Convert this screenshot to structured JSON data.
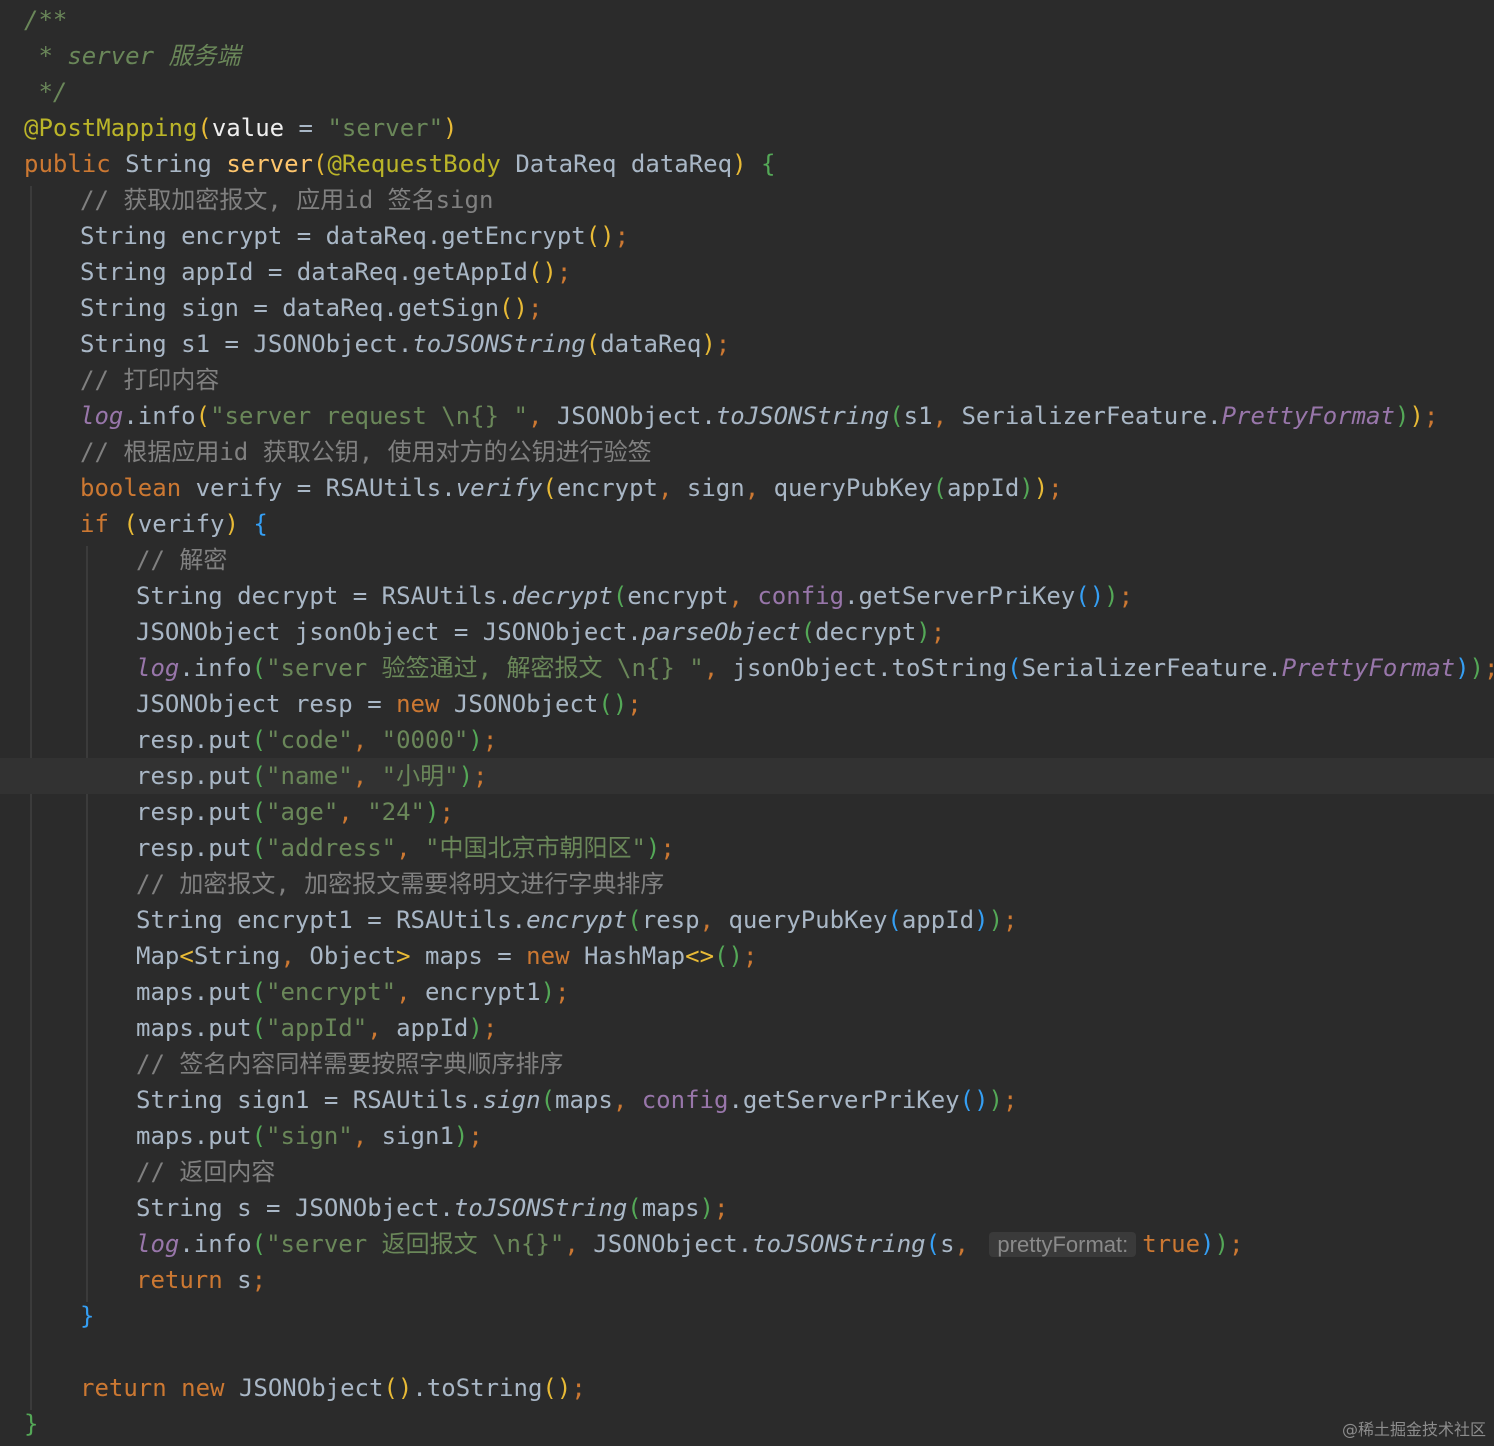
{
  "editor": {
    "lines": [
      {
        "indent": 0,
        "tokens": [
          {
            "t": "/**",
            "c": "comment"
          }
        ]
      },
      {
        "indent": 0,
        "tokens": [
          {
            "t": " * server 服务端",
            "c": "comment"
          }
        ]
      },
      {
        "indent": 0,
        "tokens": [
          {
            "t": " */",
            "c": "comment"
          }
        ]
      },
      {
        "indent": 0,
        "tokens": [
          {
            "t": "@PostMapping",
            "c": "anno"
          },
          {
            "t": "(",
            "c": "paren"
          },
          {
            "t": "value",
            "c": "param-name"
          },
          {
            "t": " = ",
            "c": "plain"
          },
          {
            "t": "\"server\"",
            "c": "str"
          },
          {
            "t": ")",
            "c": "paren"
          }
        ]
      },
      {
        "indent": 0,
        "tokens": [
          {
            "t": "public ",
            "c": "kw"
          },
          {
            "t": "String ",
            "c": "plain"
          },
          {
            "t": "server",
            "c": "fn"
          },
          {
            "t": "(",
            "c": "paren"
          },
          {
            "t": "@RequestBody ",
            "c": "anno"
          },
          {
            "t": "DataReq dataReq",
            "c": "plain"
          },
          {
            "t": ")",
            "c": "paren"
          },
          {
            "t": " {",
            "c": "paren2"
          }
        ]
      },
      {
        "indent": 1,
        "tokens": [
          {
            "t": "// 获取加密报文, 应用id 签名sign",
            "c": "linecomment"
          }
        ]
      },
      {
        "indent": 1,
        "tokens": [
          {
            "t": "String encrypt = dataReq.getEncrypt",
            "c": "plain"
          },
          {
            "t": "()",
            "c": "paren"
          },
          {
            "t": ";",
            "c": "punct"
          }
        ]
      },
      {
        "indent": 1,
        "tokens": [
          {
            "t": "String appId = dataReq.getAppId",
            "c": "plain"
          },
          {
            "t": "()",
            "c": "paren"
          },
          {
            "t": ";",
            "c": "punct"
          }
        ]
      },
      {
        "indent": 1,
        "tokens": [
          {
            "t": "String sign = dataReq.getSign",
            "c": "plain"
          },
          {
            "t": "()",
            "c": "paren"
          },
          {
            "t": ";",
            "c": "punct"
          }
        ]
      },
      {
        "indent": 1,
        "tokens": [
          {
            "t": "String s1 = JSONObject.",
            "c": "plain"
          },
          {
            "t": "toJSONString",
            "c": "static-call"
          },
          {
            "t": "(",
            "c": "paren"
          },
          {
            "t": "dataReq",
            "c": "plain"
          },
          {
            "t": ")",
            "c": "paren"
          },
          {
            "t": ";",
            "c": "punct"
          }
        ]
      },
      {
        "indent": 1,
        "tokens": [
          {
            "t": "// 打印内容",
            "c": "linecomment"
          }
        ]
      },
      {
        "indent": 1,
        "tokens": [
          {
            "t": "log",
            "c": "static-field"
          },
          {
            "t": ".info",
            "c": "plain"
          },
          {
            "t": "(",
            "c": "paren"
          },
          {
            "t": "\"server request \\n{} \"",
            "c": "str"
          },
          {
            "t": ", ",
            "c": "punct"
          },
          {
            "t": "JSONObject.",
            "c": "plain"
          },
          {
            "t": "toJSONString",
            "c": "static-call"
          },
          {
            "t": "(",
            "c": "paren2"
          },
          {
            "t": "s1",
            "c": "plain"
          },
          {
            "t": ", ",
            "c": "punct"
          },
          {
            "t": "SerializerFeature.",
            "c": "plain"
          },
          {
            "t": "PrettyFormat",
            "c": "static-field"
          },
          {
            "t": ")",
            "c": "paren2"
          },
          {
            "t": ")",
            "c": "paren"
          },
          {
            "t": ";",
            "c": "punct"
          }
        ]
      },
      {
        "indent": 1,
        "tokens": [
          {
            "t": "// 根据应用id 获取公钥, 使用对方的公钥进行验签",
            "c": "linecomment"
          }
        ]
      },
      {
        "indent": 1,
        "tokens": [
          {
            "t": "boolean ",
            "c": "kw"
          },
          {
            "t": "verify = RSAUtils.",
            "c": "plain"
          },
          {
            "t": "verify",
            "c": "static-call"
          },
          {
            "t": "(",
            "c": "paren"
          },
          {
            "t": "encrypt",
            "c": "plain"
          },
          {
            "t": ", ",
            "c": "punct"
          },
          {
            "t": "sign",
            "c": "plain"
          },
          {
            "t": ", ",
            "c": "punct"
          },
          {
            "t": "queryPubKey",
            "c": "plain"
          },
          {
            "t": "(",
            "c": "paren2"
          },
          {
            "t": "appId",
            "c": "plain"
          },
          {
            "t": ")",
            "c": "paren2"
          },
          {
            "t": ")",
            "c": "paren"
          },
          {
            "t": ";",
            "c": "punct"
          }
        ]
      },
      {
        "indent": 1,
        "tokens": [
          {
            "t": "if ",
            "c": "kw"
          },
          {
            "t": "(",
            "c": "paren"
          },
          {
            "t": "verify",
            "c": "plain"
          },
          {
            "t": ")",
            "c": "paren"
          },
          {
            "t": " {",
            "c": "paren3"
          }
        ]
      },
      {
        "indent": 2,
        "tokens": [
          {
            "t": "// 解密",
            "c": "linecomment"
          }
        ]
      },
      {
        "indent": 2,
        "tokens": [
          {
            "t": "String decrypt = RSAUtils.",
            "c": "plain"
          },
          {
            "t": "decrypt",
            "c": "static-call"
          },
          {
            "t": "(",
            "c": "paren2"
          },
          {
            "t": "encrypt",
            "c": "plain"
          },
          {
            "t": ", ",
            "c": "punct"
          },
          {
            "t": "config",
            "c": "field"
          },
          {
            "t": ".getServerPriKey",
            "c": "plain"
          },
          {
            "t": "()",
            "c": "paren3"
          },
          {
            "t": ")",
            "c": "paren2"
          },
          {
            "t": ";",
            "c": "punct"
          }
        ]
      },
      {
        "indent": 2,
        "tokens": [
          {
            "t": "JSONObject jsonObject = JSONObject.",
            "c": "plain"
          },
          {
            "t": "parseObject",
            "c": "static-call"
          },
          {
            "t": "(",
            "c": "paren2"
          },
          {
            "t": "decrypt",
            "c": "plain"
          },
          {
            "t": ")",
            "c": "paren2"
          },
          {
            "t": ";",
            "c": "punct"
          }
        ]
      },
      {
        "indent": 2,
        "tokens": [
          {
            "t": "log",
            "c": "static-field"
          },
          {
            "t": ".info",
            "c": "plain"
          },
          {
            "t": "(",
            "c": "paren2"
          },
          {
            "t": "\"server 验签通过, 解密报文 \\n{} \"",
            "c": "str"
          },
          {
            "t": ", ",
            "c": "punct"
          },
          {
            "t": "jsonObject.toString",
            "c": "plain"
          },
          {
            "t": "(",
            "c": "paren3"
          },
          {
            "t": "SerializerFeature.",
            "c": "plain"
          },
          {
            "t": "PrettyFormat",
            "c": "static-field"
          },
          {
            "t": ")",
            "c": "paren3"
          },
          {
            "t": ")",
            "c": "paren2"
          },
          {
            "t": ";",
            "c": "punct"
          }
        ]
      },
      {
        "indent": 2,
        "tokens": [
          {
            "t": "JSONObject resp = ",
            "c": "plain"
          },
          {
            "t": "new ",
            "c": "kw"
          },
          {
            "t": "JSONObject",
            "c": "plain"
          },
          {
            "t": "()",
            "c": "paren2"
          },
          {
            "t": ";",
            "c": "punct"
          }
        ]
      },
      {
        "indent": 2,
        "tokens": [
          {
            "t": "resp.put",
            "c": "plain"
          },
          {
            "t": "(",
            "c": "paren2"
          },
          {
            "t": "\"code\"",
            "c": "str"
          },
          {
            "t": ", ",
            "c": "punct"
          },
          {
            "t": "\"0000\"",
            "c": "str"
          },
          {
            "t": ")",
            "c": "paren2"
          },
          {
            "t": ";",
            "c": "punct"
          }
        ]
      },
      {
        "indent": 2,
        "current": true,
        "tokens": [
          {
            "t": "resp.put",
            "c": "plain"
          },
          {
            "t": "(",
            "c": "paren2"
          },
          {
            "t": "\"name\"",
            "c": "str"
          },
          {
            "t": ", ",
            "c": "punct"
          },
          {
            "t": "\"小明\"",
            "c": "str"
          },
          {
            "t": ")",
            "c": "paren2"
          },
          {
            "t": ";",
            "c": "punct"
          }
        ]
      },
      {
        "indent": 2,
        "tokens": [
          {
            "t": "resp.put",
            "c": "plain"
          },
          {
            "t": "(",
            "c": "paren2"
          },
          {
            "t": "\"age\"",
            "c": "str"
          },
          {
            "t": ", ",
            "c": "punct"
          },
          {
            "t": "\"24\"",
            "c": "str"
          },
          {
            "t": ")",
            "c": "paren2"
          },
          {
            "t": ";",
            "c": "punct"
          }
        ]
      },
      {
        "indent": 2,
        "tokens": [
          {
            "t": "resp.put",
            "c": "plain"
          },
          {
            "t": "(",
            "c": "paren2"
          },
          {
            "t": "\"address\"",
            "c": "str"
          },
          {
            "t": ", ",
            "c": "punct"
          },
          {
            "t": "\"中国北京市朝阳区\"",
            "c": "str"
          },
          {
            "t": ")",
            "c": "paren2"
          },
          {
            "t": ";",
            "c": "punct"
          }
        ]
      },
      {
        "indent": 2,
        "tokens": [
          {
            "t": "// 加密报文, 加密报文需要将明文进行字典排序",
            "c": "linecomment"
          }
        ]
      },
      {
        "indent": 2,
        "tokens": [
          {
            "t": "String encrypt1 = RSAUtils.",
            "c": "plain"
          },
          {
            "t": "encrypt",
            "c": "static-call"
          },
          {
            "t": "(",
            "c": "paren2"
          },
          {
            "t": "resp",
            "c": "plain"
          },
          {
            "t": ", ",
            "c": "punct"
          },
          {
            "t": "queryPubKey",
            "c": "plain"
          },
          {
            "t": "(",
            "c": "paren3"
          },
          {
            "t": "appId",
            "c": "plain"
          },
          {
            "t": ")",
            "c": "paren3"
          },
          {
            "t": ")",
            "c": "paren2"
          },
          {
            "t": ";",
            "c": "punct"
          }
        ]
      },
      {
        "indent": 2,
        "tokens": [
          {
            "t": "Map",
            "c": "plain"
          },
          {
            "t": "<",
            "c": "paren"
          },
          {
            "t": "String",
            "c": "plain"
          },
          {
            "t": ", ",
            "c": "punct"
          },
          {
            "t": "Object",
            "c": "plain"
          },
          {
            "t": ">",
            "c": "paren"
          },
          {
            "t": " maps = ",
            "c": "plain"
          },
          {
            "t": "new ",
            "c": "kw"
          },
          {
            "t": "HashMap",
            "c": "plain"
          },
          {
            "t": "<>",
            "c": "paren"
          },
          {
            "t": "()",
            "c": "paren2"
          },
          {
            "t": ";",
            "c": "punct"
          }
        ]
      },
      {
        "indent": 2,
        "tokens": [
          {
            "t": "maps.put",
            "c": "plain"
          },
          {
            "t": "(",
            "c": "paren2"
          },
          {
            "t": "\"encrypt\"",
            "c": "str"
          },
          {
            "t": ", ",
            "c": "punct"
          },
          {
            "t": "encrypt1",
            "c": "plain"
          },
          {
            "t": ")",
            "c": "paren2"
          },
          {
            "t": ";",
            "c": "punct"
          }
        ]
      },
      {
        "indent": 2,
        "tokens": [
          {
            "t": "maps.put",
            "c": "plain"
          },
          {
            "t": "(",
            "c": "paren2"
          },
          {
            "t": "\"appId\"",
            "c": "str"
          },
          {
            "t": ", ",
            "c": "punct"
          },
          {
            "t": "appId",
            "c": "plain"
          },
          {
            "t": ")",
            "c": "paren2"
          },
          {
            "t": ";",
            "c": "punct"
          }
        ]
      },
      {
        "indent": 2,
        "tokens": [
          {
            "t": "// 签名内容同样需要按照字典顺序排序",
            "c": "linecomment"
          }
        ]
      },
      {
        "indent": 2,
        "tokens": [
          {
            "t": "String sign1 = RSAUtils.",
            "c": "plain"
          },
          {
            "t": "sign",
            "c": "static-call"
          },
          {
            "t": "(",
            "c": "paren2"
          },
          {
            "t": "maps",
            "c": "plain"
          },
          {
            "t": ", ",
            "c": "punct"
          },
          {
            "t": "config",
            "c": "field"
          },
          {
            "t": ".getServerPriKey",
            "c": "plain"
          },
          {
            "t": "()",
            "c": "paren3"
          },
          {
            "t": ")",
            "c": "paren2"
          },
          {
            "t": ";",
            "c": "punct"
          }
        ]
      },
      {
        "indent": 2,
        "tokens": [
          {
            "t": "maps.put",
            "c": "plain"
          },
          {
            "t": "(",
            "c": "paren2"
          },
          {
            "t": "\"sign\"",
            "c": "str"
          },
          {
            "t": ", ",
            "c": "punct"
          },
          {
            "t": "sign1",
            "c": "plain"
          },
          {
            "t": ")",
            "c": "paren2"
          },
          {
            "t": ";",
            "c": "punct"
          }
        ]
      },
      {
        "indent": 2,
        "tokens": [
          {
            "t": "// 返回内容",
            "c": "linecomment"
          }
        ]
      },
      {
        "indent": 2,
        "tokens": [
          {
            "t": "String s = JSONObject.",
            "c": "plain"
          },
          {
            "t": "toJSONString",
            "c": "static-call"
          },
          {
            "t": "(",
            "c": "paren2"
          },
          {
            "t": "maps",
            "c": "plain"
          },
          {
            "t": ")",
            "c": "paren2"
          },
          {
            "t": ";",
            "c": "punct"
          }
        ]
      },
      {
        "indent": 2,
        "tokens": [
          {
            "t": "log",
            "c": "static-field"
          },
          {
            "t": ".info",
            "c": "plain"
          },
          {
            "t": "(",
            "c": "paren2"
          },
          {
            "t": "\"server 返回报文 \\n{}\"",
            "c": "str"
          },
          {
            "t": ", ",
            "c": "punct"
          },
          {
            "t": "JSONObject.",
            "c": "plain"
          },
          {
            "t": "toJSONString",
            "c": "static-call"
          },
          {
            "t": "(",
            "c": "paren3"
          },
          {
            "t": "s",
            "c": "plain"
          },
          {
            "t": ", ",
            "c": "punct"
          },
          {
            "t": "prettyFormat:",
            "c": "hint"
          },
          {
            "t": "true",
            "c": "kw"
          },
          {
            "t": ")",
            "c": "paren3"
          },
          {
            "t": ")",
            "c": "paren2"
          },
          {
            "t": ";",
            "c": "punct"
          }
        ]
      },
      {
        "indent": 2,
        "tokens": [
          {
            "t": "return ",
            "c": "kw"
          },
          {
            "t": "s",
            "c": "plain"
          },
          {
            "t": ";",
            "c": "punct"
          }
        ]
      },
      {
        "indent": 1,
        "tokens": [
          {
            "t": "}",
            "c": "paren3"
          }
        ]
      },
      {
        "indent": 0,
        "tokens": []
      },
      {
        "indent": 1,
        "tokens": [
          {
            "t": "return new ",
            "c": "kw"
          },
          {
            "t": "JSONObject",
            "c": "plain"
          },
          {
            "t": "()",
            "c": "paren"
          },
          {
            "t": ".toString",
            "c": "plain"
          },
          {
            "t": "()",
            "c": "paren"
          },
          {
            "t": ";",
            "c": "punct"
          }
        ]
      },
      {
        "indent": 0,
        "tokens": [
          {
            "t": "}",
            "c": "paren2"
          }
        ]
      }
    ]
  },
  "watermark": "@稀土掘金技术社区"
}
